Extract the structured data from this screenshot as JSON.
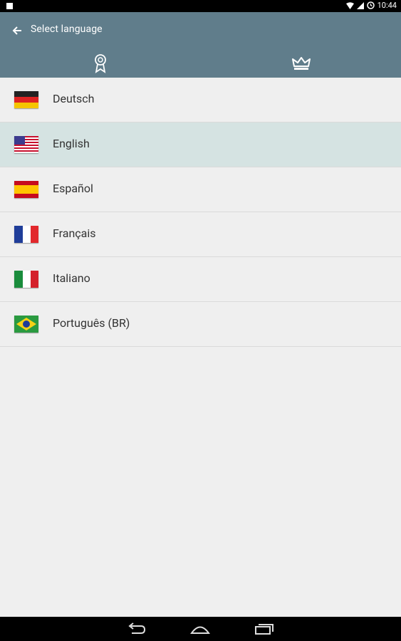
{
  "status": {
    "time": "10:44"
  },
  "header": {
    "title": "Select language"
  },
  "tabs": [
    {
      "name": "tab-achievements",
      "icon": "ribbon-icon"
    },
    {
      "name": "tab-premium",
      "icon": "crown-icon"
    }
  ],
  "languages": [
    {
      "label": "Deutsch",
      "flag": "de-flag"
    },
    {
      "label": "English",
      "flag": "us-flag",
      "selected": true
    },
    {
      "label": "Español",
      "flag": "es-flag"
    },
    {
      "label": "Français",
      "flag": "fr-flag"
    },
    {
      "label": "Italiano",
      "flag": "it-flag"
    },
    {
      "label": "Português (BR)",
      "flag": "br-flag"
    }
  ],
  "colors": {
    "appbar": "#607d8b",
    "selected_row": "#d5e3e2",
    "background": "#efefef"
  }
}
